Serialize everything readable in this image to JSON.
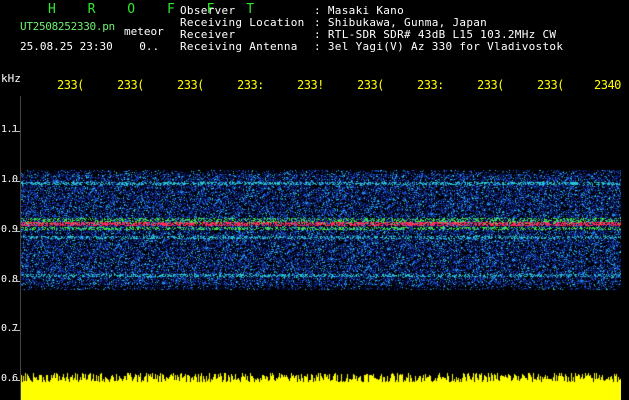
{
  "header": {
    "title": "H R O F F T",
    "filename": "UT2508252330.pn",
    "plot_type": "meteor",
    "date_time": "25.08.25 23:30",
    "counter": "0..",
    "fields": [
      {
        "label": "Observer",
        "sep": ":",
        "value": "Masaki Kano"
      },
      {
        "label": "Receiving Location",
        "sep": ":",
        "value": "Shibukawa, Gunma, Japan"
      },
      {
        "label": "Receiver",
        "sep": ":",
        "value": "RTL-SDR SDR# 43dB L15 103.2MHz CW"
      },
      {
        "label": "Receiving Antenna",
        "sep": ":",
        "value": "3el Yagi(V) Az 330 for Vladivostok"
      }
    ]
  },
  "spectrogram": {
    "y_unit": "kHz",
    "y_ticks": [
      "1.1",
      "1.0",
      "0.9",
      "0.8",
      "0.7",
      "0.6"
    ],
    "x_ticks": [
      "233(",
      "233(",
      "233(",
      "233:",
      "233!",
      "233(",
      "233:",
      "233(",
      "233(",
      "2340"
    ],
    "colors": {
      "background": "#000000",
      "noise_low": "#0a1a6e",
      "noise_mid": "#1e5adc",
      "noise_high": "#28c8d2",
      "band_peak": "#ff2a5a",
      "band_mid": "#46e646",
      "signal_level": "#ffff00"
    }
  }
}
